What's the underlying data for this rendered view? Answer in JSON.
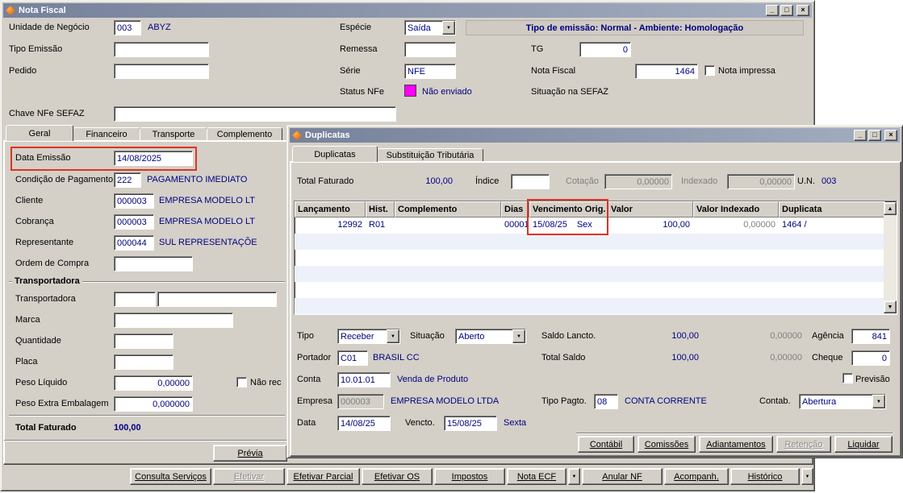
{
  "colors": {
    "value_text": "#000080",
    "status_swatch": "#ff00ff",
    "highlight_box": "#dd3322",
    "titlebar_left": "#76819b",
    "titlebar_right": "#a4aec0"
  },
  "icons": {
    "minimize": "_",
    "maximize": "□",
    "close": "×",
    "dropdown": "▼",
    "scroll_up": "▲",
    "scroll_down": "▼"
  },
  "main": {
    "title": "Nota Fiscal",
    "fields": {
      "unidade_label": "Unidade de Negócio",
      "unidade_value": "003",
      "unidade_desc": "ABYZ",
      "tipo_emissao_label": "Tipo Emissão",
      "pedido_label": "Pedido",
      "chave_label": "Chave NFe SEFAZ",
      "especie_label": "Espécie",
      "especie_value": "Saída",
      "remessa_label": "Remessa",
      "serie_label": "Série",
      "serie_value": "NFE",
      "status_label": "Status NFe",
      "status_value": "Não enviado",
      "tg_label": "TG",
      "tg_value": "0",
      "nf_label": "Nota Fiscal",
      "nf_value": "1464",
      "nota_impressa_label": "Nota impressa",
      "situacao_sefaz_label": "Situação na SEFAZ",
      "banner": "Tipo de emissão: Normal - Ambiente: Homologação"
    },
    "tabs": [
      "Geral",
      "Financeiro",
      "Transporte",
      "Complemento"
    ],
    "geral": {
      "data_emissao_label": "Data Emissão",
      "data_emissao_value": "14/08/2025",
      "cond_pag_label": "Condição de Pagamento",
      "cond_pag_code": "222",
      "cond_pag_desc": "PAGAMENTO IMEDIATO",
      "cliente_label": "Cliente",
      "cliente_code": "000003",
      "cliente_desc": "EMPRESA MODELO LT",
      "cobranca_label": "Cobrança",
      "cobranca_code": "000003",
      "cobranca_desc": "EMPRESA MODELO LT",
      "representante_label": "Representante",
      "representante_code": "000044",
      "representante_desc": "SUL REPRESENTAÇÕE",
      "ordem_label": "Ordem de Compra",
      "transportadora_group": "Transportadora",
      "transportadora_label": "Transportadora",
      "marca_label": "Marca",
      "quantidade_label": "Quantidade",
      "placa_label": "Placa",
      "peso_liquido_label": "Peso Líquido",
      "peso_liquido_value": "0,00000",
      "nao_rec_label": "Não rec",
      "peso_extra_label": "Peso Extra Embalagem",
      "peso_extra_value": "0,000000",
      "total_label": "Total Faturado",
      "total_value": "100,00",
      "previa_button": "Prévia"
    },
    "footer_buttons": [
      "Consulta Serviços",
      "Efetivar",
      "Efetivar Parcial",
      "Efetivar OS",
      "Impostos",
      "Nota ECF",
      "Anular NF",
      "Acompanh.",
      "Histórico"
    ]
  },
  "dup": {
    "title": "Duplicatas",
    "tabs": [
      "Duplicatas",
      "Substituição Tributária"
    ],
    "summary": {
      "total_label": "Total Faturado",
      "total_value": "100,00",
      "indice_label": "Índice",
      "cotacao_label": "Cotação",
      "cotacao_value": "0,00000",
      "indexado_label": "Indexado",
      "indexado_value": "0,00000",
      "un_label": "U.N.",
      "un_value": "003"
    },
    "table": {
      "columns": [
        "Lançamento",
        "Hist.",
        "Complemento",
        "Dias",
        "Vencimento Orig.",
        "Valor",
        "Valor Indexado",
        "Duplicata"
      ],
      "row": {
        "lancamento": "12992",
        "hist": "R01",
        "complemento": "",
        "dias": "00001",
        "venc_date": "15/08/25",
        "venc_dow": "Sex",
        "valor": "100,00",
        "valor_indexado": "0,00000",
        "duplicata": "1464 /"
      }
    },
    "details": {
      "tipo_label": "Tipo",
      "tipo_value": "Receber",
      "situacao_label": "Situação",
      "situacao_value": "Aberto",
      "saldo_lancto_label": "Saldo Lancto.",
      "saldo_lancto_value": "100,00",
      "saldo_lancto_idx": "0,00000",
      "agencia_label": "Agência",
      "agencia_value": "841",
      "portador_label": "Portador",
      "portador_code": "C01",
      "portador_desc": "BRASIL CC",
      "total_saldo_label": "Total Saldo",
      "total_saldo_value": "100,00",
      "total_saldo_idx": "0,00000",
      "cheque_label": "Cheque",
      "cheque_value": "0",
      "conta_label": "Conta",
      "conta_code": "10.01.01",
      "conta_desc": "Venda de Produto",
      "previsao_label": "Previsão",
      "empresa_label": "Empresa",
      "empresa_code": "000003",
      "empresa_desc": "EMPRESA MODELO LTDA",
      "tipo_pagto_label": "Tipo Pagto.",
      "tipo_pagto_code": "08",
      "tipo_pagto_desc": "CONTA CORRENTE",
      "contab_label": "Contab.",
      "contab_value": "Abertura",
      "data_label": "Data",
      "data_value": "14/08/25",
      "vencto_label": "Vencto.",
      "vencto_value": "15/08/25",
      "vencto_dow": "Sexta"
    },
    "footer_buttons": [
      "Contábil",
      "Comissões",
      "Adiantamentos",
      "Retenção",
      "Liquidar"
    ]
  }
}
